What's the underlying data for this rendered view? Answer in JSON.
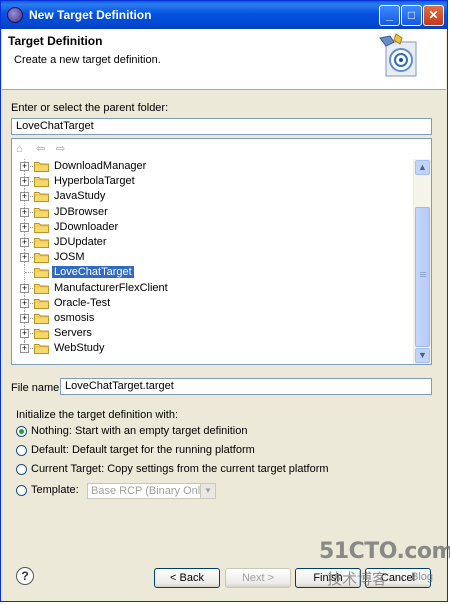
{
  "window": {
    "title": "New Target Definition",
    "controls": [
      "_",
      "□",
      "✕"
    ]
  },
  "header": {
    "title": "Target Definition",
    "description": "Create a new target definition."
  },
  "parent_folder": {
    "label": "Enter or select the parent folder:",
    "value": "LoveChatTarget"
  },
  "tree": {
    "items": [
      {
        "label": "DownloadManager",
        "expandable": true,
        "selected": false
      },
      {
        "label": "HyperbolaTarget",
        "expandable": true,
        "selected": false
      },
      {
        "label": "JavaStudy",
        "expandable": true,
        "selected": false
      },
      {
        "label": "JDBrowser",
        "expandable": true,
        "selected": false
      },
      {
        "label": "JDownloader",
        "expandable": true,
        "selected": false
      },
      {
        "label": "JDUpdater",
        "expandable": true,
        "selected": false
      },
      {
        "label": "JOSM",
        "expandable": true,
        "selected": false
      },
      {
        "label": "LoveChatTarget",
        "expandable": false,
        "selected": true
      },
      {
        "label": "ManufacturerFlexClient",
        "expandable": true,
        "selected": false
      },
      {
        "label": "Oracle-Test",
        "expandable": true,
        "selected": false
      },
      {
        "label": "osmosis",
        "expandable": true,
        "selected": false
      },
      {
        "label": "Servers",
        "expandable": true,
        "selected": false
      },
      {
        "label": "WebStudy",
        "expandable": true,
        "selected": false
      }
    ]
  },
  "file_name": {
    "label": "File name:",
    "value": "LoveChatTarget.target"
  },
  "init": {
    "heading": "Initialize the target definition with:",
    "options": [
      {
        "label": "Nothing: Start with an empty target definition",
        "checked": true
      },
      {
        "label": "Default: Default target for the running platform",
        "checked": false
      },
      {
        "label": "Current Target: Copy settings from the current target platform",
        "checked": false
      },
      {
        "label": "Template:",
        "checked": false
      }
    ],
    "template_value": "Base RCP (Binary Only)"
  },
  "buttons": {
    "help": "?",
    "back": "< Back",
    "next": "Next >",
    "finish": "Finish",
    "cancel": "Cancel"
  },
  "watermark": {
    "site": "51CTO.com",
    "cn": "技术博客",
    "blog": "Blog"
  },
  "colors": {
    "selection": "#316ac5",
    "titlebar": "#0553e1",
    "dialog_bg": "#ece9d8"
  }
}
